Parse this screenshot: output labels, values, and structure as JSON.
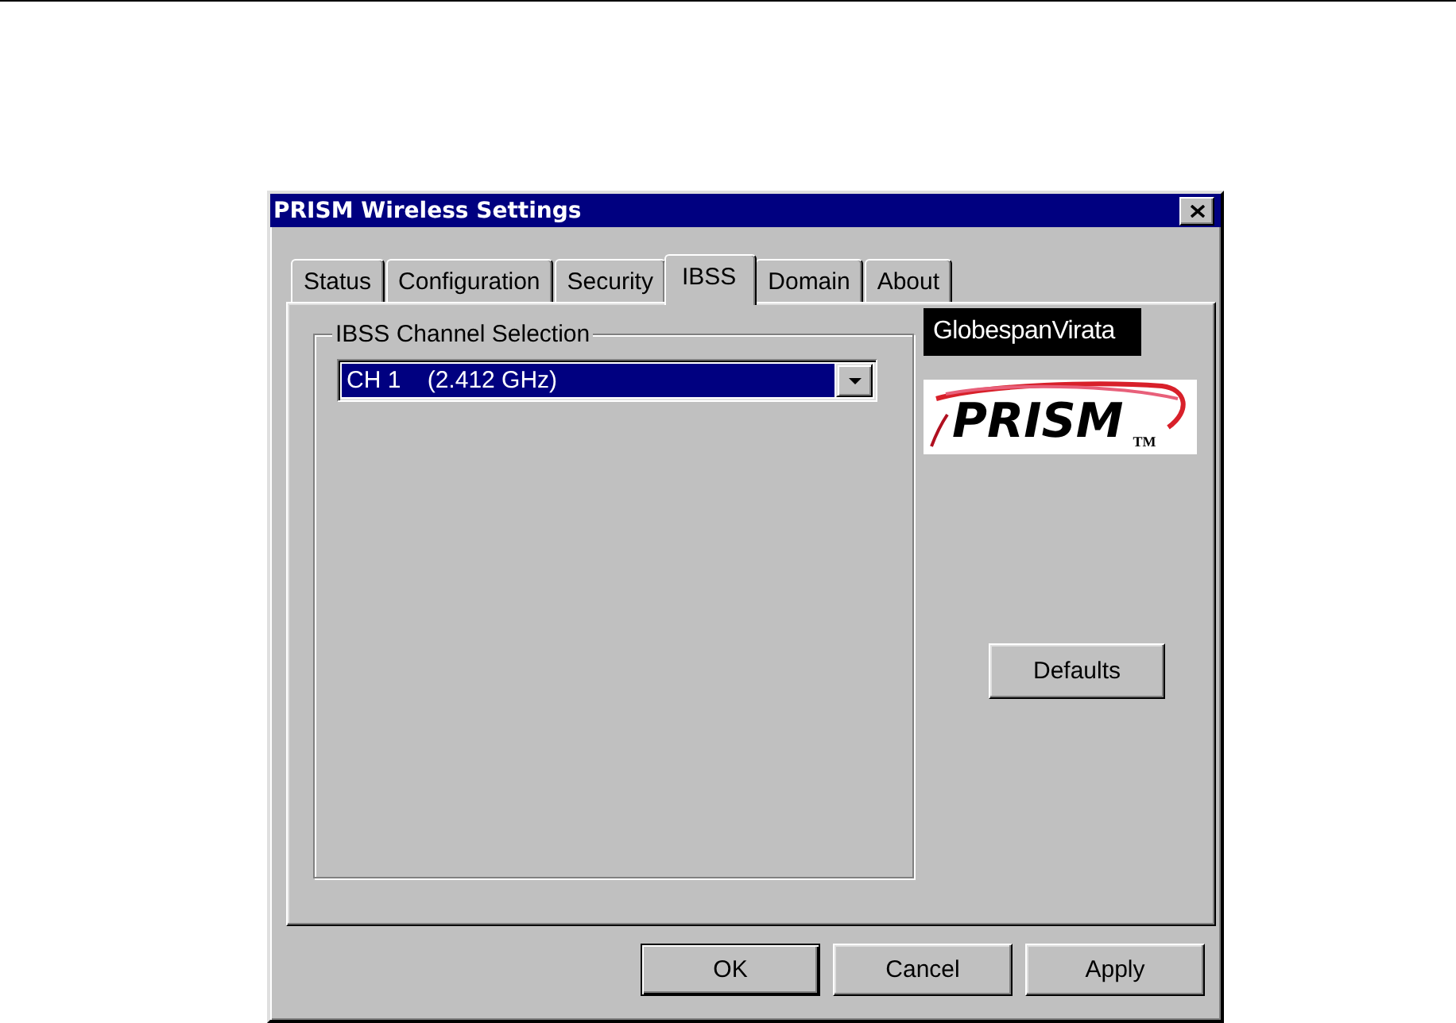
{
  "window": {
    "title": "PRISM Wireless Settings"
  },
  "tabs": [
    {
      "label": "Status",
      "selected": false
    },
    {
      "label": "Configuration",
      "selected": false
    },
    {
      "label": "Security",
      "selected": false
    },
    {
      "label": "IBSS",
      "selected": true
    },
    {
      "label": "Domain",
      "selected": false
    },
    {
      "label": "About",
      "selected": false
    }
  ],
  "channel_selection": {
    "label": "IBSS Channel Selection",
    "value": "CH 1    (2.412 GHz)",
    "highlighted": true
  },
  "logos": [
    {
      "kind": "wordmark",
      "text": "GlobespanVirata"
    },
    {
      "kind": "swoosh",
      "text": "PRISM",
      "mark": "TM"
    }
  ],
  "side_button": {
    "label": "Defaults"
  },
  "buttons": [
    {
      "label": "OK",
      "default": true
    },
    {
      "label": "Cancel",
      "default": false
    },
    {
      "label": "Apply",
      "default": false
    }
  ]
}
